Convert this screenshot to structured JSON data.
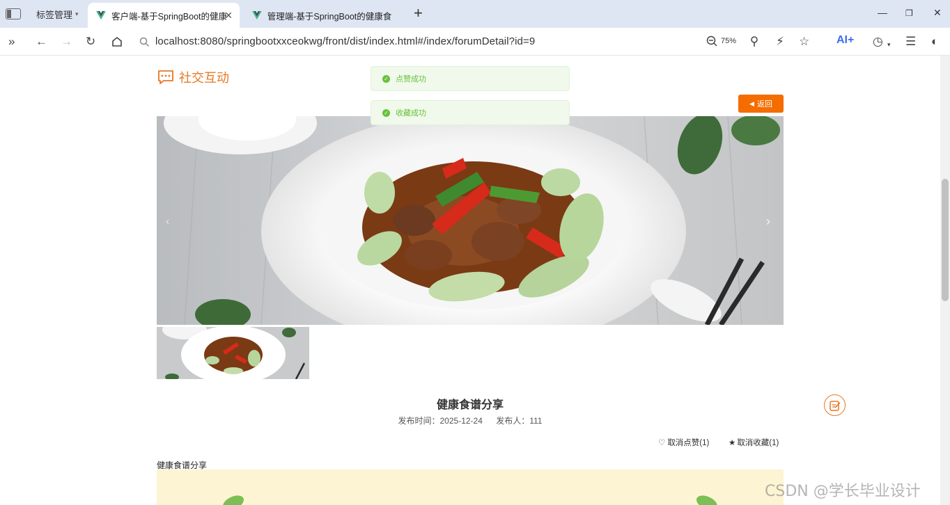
{
  "browser": {
    "tab_manager_label": "标签管理",
    "tabs": [
      {
        "title": "客户端-基于SpringBoot的健康",
        "active": true
      },
      {
        "title": "管理端-基于SpringBoot的健康食",
        "active": false
      }
    ],
    "url": "localhost:8080/springbootxxceokwg/front/dist/index.html#/index/forumDetail?id=9",
    "zoom": "75%",
    "ai_label": "AI+"
  },
  "page": {
    "section_title": "社交互动",
    "toasts": [
      "点赞成功",
      "收藏成功"
    ],
    "back_label": "返回",
    "post": {
      "title": "健康食谱分享",
      "publish_time_label": "发布时间：2025-12-24",
      "publisher_label": "发布人：111",
      "unlike_label": "取消点赞(1)",
      "uncollect_label": "取消收藏(1)",
      "body_text": "健康食谱分享"
    }
  },
  "watermark": "CSDN @学长毕业设计",
  "colors": {
    "accent": "#e87722",
    "back_button": "#f56c00",
    "toast_bg": "#f0f9eb",
    "toast_text": "#67c23a",
    "tabbar": "#dfe6f3"
  }
}
